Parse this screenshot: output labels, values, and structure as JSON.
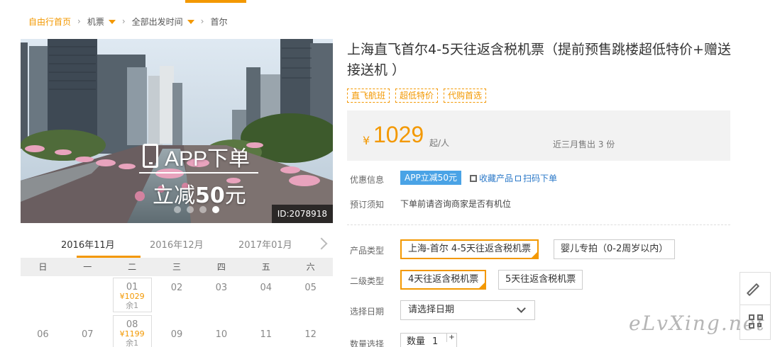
{
  "breadcrumb": {
    "home": "自由行首页",
    "cat1": "机票",
    "cat2": "全部出发时间",
    "current": "首尔"
  },
  "hero": {
    "app_text": "APP下单",
    "discount_prefix": "立减",
    "discount_value": "50",
    "discount_suffix": "元",
    "id_label": "ID:2078918",
    "slide_count": 4,
    "active_slide": 4
  },
  "calendar": {
    "months": [
      "2016年11月",
      "2016年12月",
      "2017年01月"
    ],
    "active_month": 0,
    "weekdays": [
      "日",
      "一",
      "二",
      "三",
      "四",
      "五",
      "六"
    ],
    "rows": [
      [
        {
          "day": ""
        },
        {
          "day": ""
        },
        {
          "day": "01",
          "price": "¥1029",
          "left": "余1"
        },
        {
          "day": "02"
        },
        {
          "day": "03"
        },
        {
          "day": "04"
        },
        {
          "day": "05"
        }
      ],
      [
        {
          "day": "06"
        },
        {
          "day": "07"
        },
        {
          "day": "08",
          "price": "¥1199",
          "left": "余1"
        },
        {
          "day": "09"
        },
        {
          "day": "10"
        },
        {
          "day": "11"
        },
        {
          "day": "12"
        }
      ]
    ]
  },
  "product": {
    "title": "上海直飞首尔4-5天往返含税机票（提前预售跳楼超低特价+赠送接送机 ）",
    "tags": [
      "直飞航班",
      "超低特价",
      "代购首选"
    ],
    "price_symbol": "¥",
    "price": "1029",
    "price_unit": "起/人",
    "sold": "近三月售出 3 份"
  },
  "info": {
    "promo_label": "优惠信息",
    "promo_badge": "APP立减50元",
    "collect": "收藏产品",
    "scan": "扫码下单",
    "notice_label": "预订须知",
    "notice_text": "下单前请咨询商家是否有机位"
  },
  "options": {
    "type_label": "产品类型",
    "types": [
      "上海-首尔 4-5天往返含税机票",
      "婴儿专拍（0-2周岁以内）"
    ],
    "subtype_label": "二级类型",
    "subtypes": [
      "4天往返含税机票",
      "5天往返含税机票"
    ],
    "date_label": "选择日期",
    "date_placeholder": "请选择日期",
    "qty_label": "数量选择",
    "qty_prefix": "数量",
    "qty_value": "1",
    "qty_plus": "+"
  },
  "watermark": "eLvXing.net",
  "colors": {
    "accent": "#f39800",
    "link": "#2a78c8",
    "badge": "#4aa3e6"
  }
}
